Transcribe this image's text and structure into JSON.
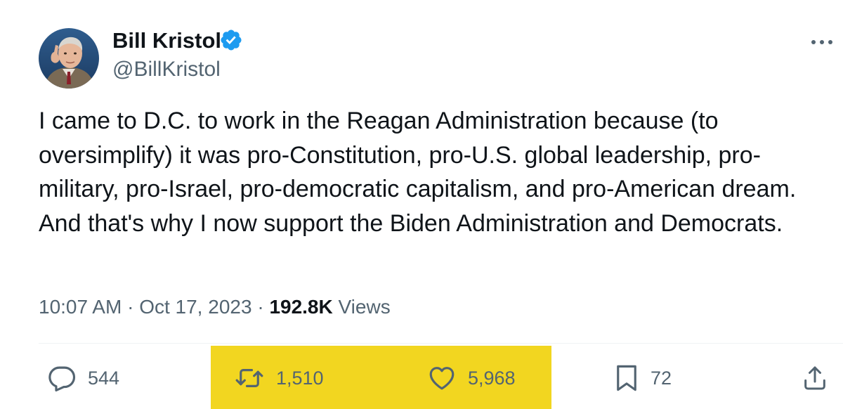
{
  "author": {
    "name": "Bill Kristol",
    "handle": "@BillKristol",
    "verified": true,
    "verified_color": "#1d9bf0"
  },
  "icons": {
    "more": "more-horizontal-icon",
    "verified": "verified-badge-icon",
    "reply": "reply-bubble-icon",
    "retweet": "retweet-icon",
    "like": "heart-icon",
    "bookmark": "bookmark-icon",
    "share": "share-upload-icon"
  },
  "tweet": {
    "text": "I came to D.C. to work in the Reagan Administration because (to oversimplify) it was pro-Constitution, pro-U.S. global leadership, pro-military, pro-Israel, pro-democratic capitalism, and pro-American dream. And that's why I now support the Biden Administration and Democrats."
  },
  "meta": {
    "time": "10:07 AM",
    "separator": "·",
    "date": "Oct 17, 2023",
    "views_count": "192.8K",
    "views_label": "Views"
  },
  "actions": {
    "replies": "544",
    "retweets": "1,510",
    "likes": "5,968",
    "bookmarks": "72"
  },
  "colors": {
    "text": "#0f1419",
    "secondary": "#536471",
    "highlight": "#f2d620"
  }
}
